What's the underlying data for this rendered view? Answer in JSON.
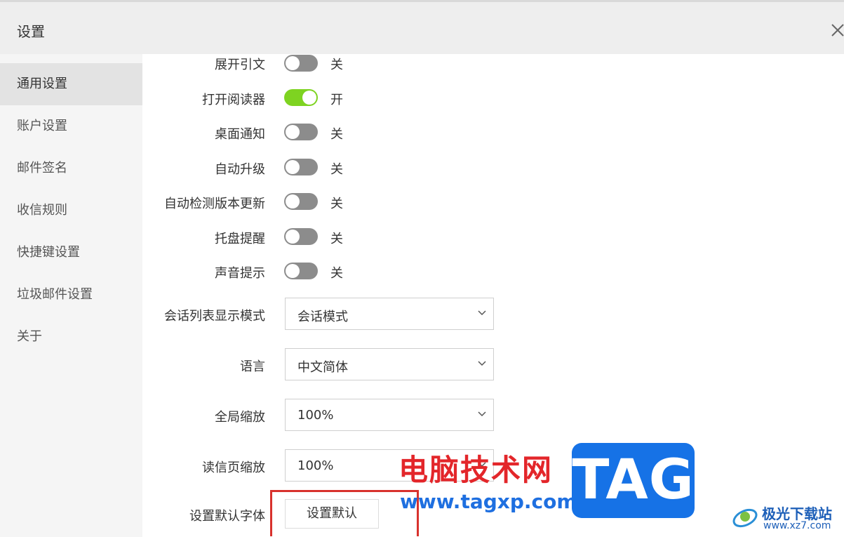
{
  "window": {
    "title": "设置"
  },
  "sidebar": {
    "items": [
      {
        "label": "通用设置",
        "active": true
      },
      {
        "label": "账户设置",
        "active": false
      },
      {
        "label": "邮件签名",
        "active": false
      },
      {
        "label": "收信规则",
        "active": false
      },
      {
        "label": "快捷键设置",
        "active": false
      },
      {
        "label": "垃圾邮件设置",
        "active": false
      },
      {
        "label": "关于",
        "active": false
      }
    ]
  },
  "settings": {
    "toggles": [
      {
        "label": "展开引文",
        "on": false,
        "state": "关"
      },
      {
        "label": "打开阅读器",
        "on": true,
        "state": "开"
      },
      {
        "label": "桌面通知",
        "on": false,
        "state": "关"
      },
      {
        "label": "自动升级",
        "on": false,
        "state": "关"
      },
      {
        "label": "自动检测版本更新",
        "on": false,
        "state": "关"
      },
      {
        "label": "托盘提醒",
        "on": false,
        "state": "关"
      },
      {
        "label": "声音提示",
        "on": false,
        "state": "关"
      }
    ],
    "selects": [
      {
        "label": "会话列表显示模式",
        "value": "会话模式"
      },
      {
        "label": "语言",
        "value": "中文简体"
      },
      {
        "label": "全局缩放",
        "value": "100%"
      },
      {
        "label": "读信页缩放",
        "value": "100%"
      }
    ],
    "default_font": {
      "label": "设置默认字体",
      "button": "设置默认"
    }
  },
  "watermark": {
    "site_cn": "电脑技术网",
    "site_url": "www.tagxp.com",
    "tag": "TAG",
    "brand_cn": "极光下载站",
    "brand_url": "www.xz7.com"
  },
  "colors": {
    "toggle_on": "#7ed321",
    "toggle_off": "#8c8c8c",
    "highlight": "#d8322d",
    "tag_blue": "#1672e6"
  }
}
